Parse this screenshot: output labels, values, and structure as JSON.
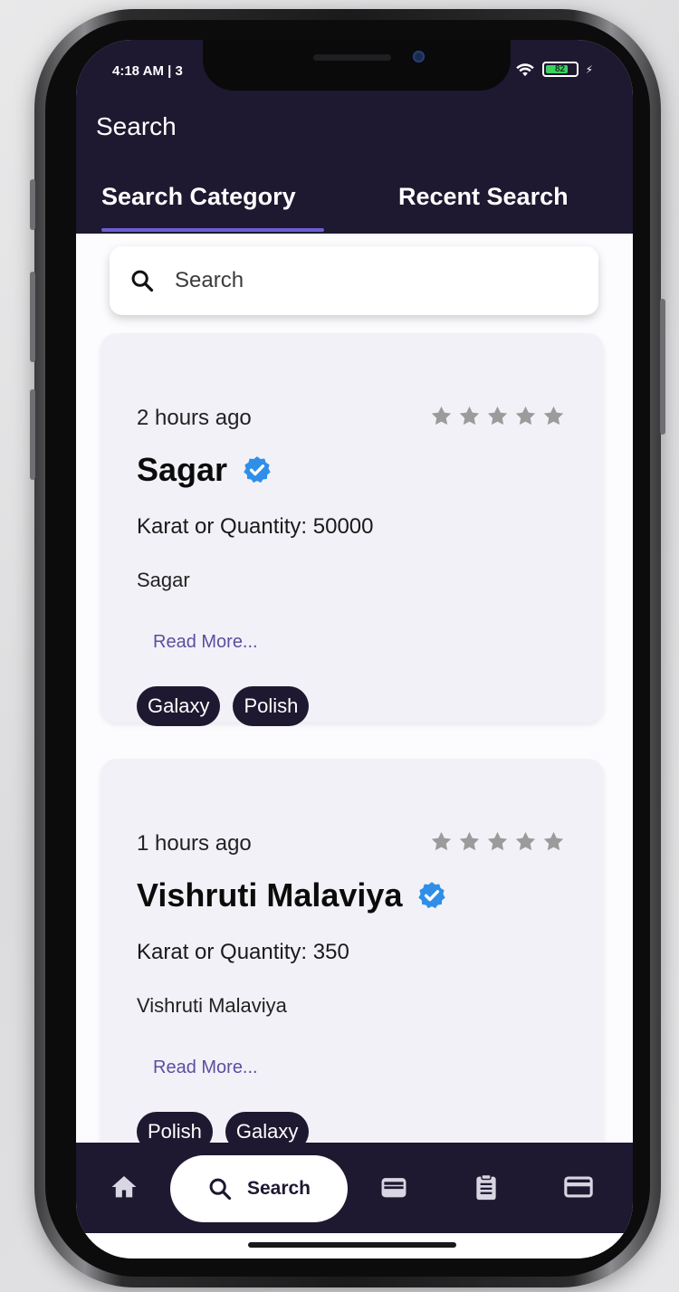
{
  "status_bar": {
    "time": "4:18 AM | 3",
    "battery": "82"
  },
  "header": {
    "title": "Search",
    "tabs": [
      {
        "label": "Search Category",
        "active": true
      },
      {
        "label": "Recent Search",
        "active": false
      }
    ]
  },
  "search": {
    "placeholder": "Search",
    "value": ""
  },
  "cards": [
    {
      "time": "2 hours ago",
      "rating": 0,
      "max_rating": 5,
      "name": "Sagar",
      "quantity": "Karat or Quantity: 50000",
      "description": "Sagar",
      "read_more": "Read More...",
      "tags": [
        "Galaxy",
        "Polish"
      ]
    },
    {
      "time": "1 hours ago",
      "rating": 0,
      "max_rating": 5,
      "name": "Vishruti Malaviya",
      "quantity": "Karat or Quantity: 350",
      "description": "Vishruti Malaviya",
      "read_more": "Read More...",
      "tags": [
        "Polish",
        "Galaxy"
      ]
    }
  ],
  "bottom_nav": {
    "items": [
      {
        "icon": "home-icon"
      },
      {
        "icon": "search-icon",
        "label": "Search",
        "active": true
      },
      {
        "icon": "wallet-icon"
      },
      {
        "icon": "clipboard-icon"
      },
      {
        "icon": "credit-card-icon"
      }
    ]
  },
  "colors": {
    "primary": "#1e1830",
    "accent": "#6c5fd1",
    "verified": "#2f8fe8",
    "star_inactive": "#9b9b9b",
    "card_bg": "#f3f1f8"
  }
}
